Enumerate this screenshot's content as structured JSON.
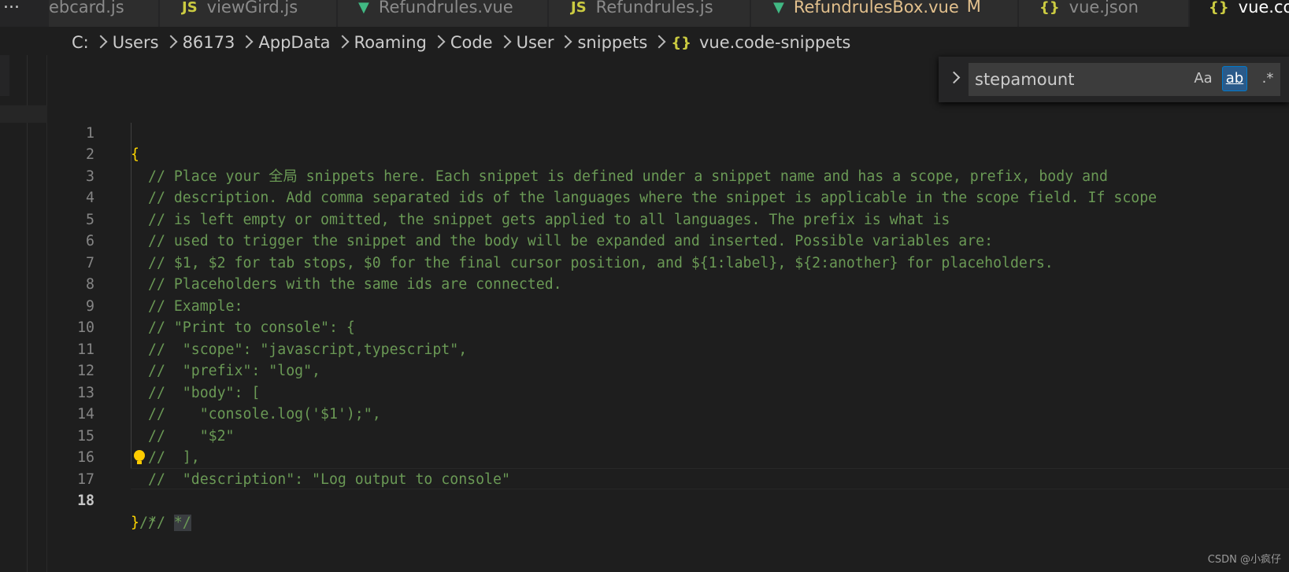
{
  "tabs": [
    {
      "label": "ebcard.js",
      "icon": "js-icon"
    },
    {
      "label": "viewGird.js",
      "icon": "js-icon"
    },
    {
      "label": "Refundrules.vue",
      "icon": "vue-icon"
    },
    {
      "label": "Refundrules.js",
      "icon": "js-icon"
    },
    {
      "label": "RefundrulesBox.vue",
      "icon": "vue-icon",
      "modified_mark": "M"
    },
    {
      "label": "vue.json",
      "icon": "json-icon"
    },
    {
      "label": "vue.code-snippets",
      "icon": "json-icon",
      "active": true
    }
  ],
  "tab_icons": {
    "js": "JS",
    "vue": "▼",
    "json": "{}"
  },
  "more_glyph": "...",
  "breadcrumb": {
    "items": [
      "C:",
      "Users",
      "86173",
      "AppData",
      "Roaming",
      "Code",
      "User",
      "snippets"
    ],
    "file_icon": "{}",
    "file": "vue.code-snippets"
  },
  "find": {
    "value": "stepamount",
    "match_case": "Aa",
    "whole_word": "ab",
    "regex": ".*"
  },
  "editor": {
    "current_line": 18,
    "lines": [
      {
        "n": "1",
        "text": "{"
      },
      {
        "n": "2",
        "text": "// Place your 全局 snippets here. Each snippet is defined under a snippet name and has a scope, prefix, body and"
      },
      {
        "n": "3",
        "text": "// description. Add comma separated ids of the languages where the snippet is applicable in the scope field. If scope"
      },
      {
        "n": "4",
        "text": "// is left empty or omitted, the snippet gets applied to all languages. The prefix is what is"
      },
      {
        "n": "5",
        "text": "// used to trigger the snippet and the body will be expanded and inserted. Possible variables are:"
      },
      {
        "n": "6",
        "text": "// $1, $2 for tab stops, $0 for the final cursor position, and ${1:label}, ${2:another} for placeholders."
      },
      {
        "n": "7",
        "text": "// Placeholders with the same ids are connected."
      },
      {
        "n": "8",
        "text": "// Example:"
      },
      {
        "n": "9",
        "text": "// \"Print to console\": {"
      },
      {
        "n": "10",
        "text": "//  \"scope\": \"javascript,typescript\","
      },
      {
        "n": "11",
        "text": "//  \"prefix\": \"log\","
      },
      {
        "n": "12",
        "text": "//  \"body\": ["
      },
      {
        "n": "13",
        "text": "//    \"console.log('$1');\","
      },
      {
        "n": "14",
        "text": "//    \"$2\""
      },
      {
        "n": "15",
        "text": "//  ],"
      },
      {
        "n": "16",
        "text": "//  \"description\": \"Log output to console\""
      },
      {
        "n": "17",
        "text": "// }"
      },
      {
        "n": "18",
        "brace": "}",
        "comment_open": "/*  ",
        "comment_close": "*/"
      }
    ]
  },
  "watermark": "CSDN @小疯仔"
}
